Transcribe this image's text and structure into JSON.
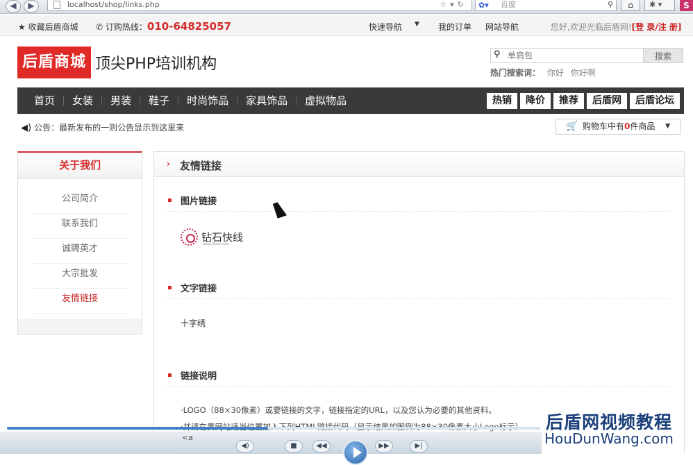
{
  "browser": {
    "url": "localhost/shop/links.php",
    "search_engine_placeholder": "百度"
  },
  "topbar": {
    "favorite": "收藏后盾商城",
    "hotline_label": "订购热线：",
    "hotline_number": "010-64825057",
    "quick_nav": "快速导航",
    "my_orders": "我的订单",
    "site_nav": "网站导航",
    "welcome": "您好,欢迎光临后盾网!",
    "login": "登 录",
    "register": "注 册"
  },
  "header": {
    "logo": "后盾商城",
    "slogan": "顶尖PHP培训机构",
    "search_placeholder": "单肩包",
    "search_button": "搜索",
    "hot_label": "热门搜索词：",
    "hot_words": [
      "你好",
      "你好啊"
    ]
  },
  "nav": {
    "items": [
      "首页",
      "女装",
      "男装",
      "鞋子",
      "时尚饰品",
      "家具饰品",
      "虚拟物品"
    ],
    "tags": [
      "热销",
      "降价",
      "推荐",
      "后盾网",
      "后盾论坛"
    ]
  },
  "notice": {
    "text": "公告：最新发布的一则公告显示到这里来"
  },
  "cart": {
    "prefix": "购物车中有",
    "count": "0",
    "suffix": "件商品"
  },
  "sidebar": {
    "title": "关于我们",
    "items": [
      "公司简介",
      "联系我们",
      "诚聘英才",
      "大宗批发",
      "友情链接"
    ],
    "active_index": 4
  },
  "content": {
    "title": "友情链接",
    "image_links_title": "图片链接",
    "partner_name": "钻石快线",
    "partner_url": "www.3bbk.com",
    "text_links_title": "文字链接",
    "text_link": "十字绣",
    "note_title": "链接说明",
    "note_lines": [
      "·LOGO（88×30像素）或要链接的文字，链接指定的URL，以及您认为必要的其他资料。",
      "·并请在贵网站适当位置加入下列HTML链接代码（显示结果如图例为88×30像素大小Logo标示）"
    ]
  },
  "watermark": {
    "cn": "后盾网视频教程",
    "en": "HouDunWang.com"
  },
  "player": {
    "code_fragment": "<a",
    "progress": 0.49
  },
  "colors": {
    "brand_red": "#e02a27",
    "nav_bg": "#3a3a3a",
    "watermark_blue": "#1a3f7a"
  }
}
